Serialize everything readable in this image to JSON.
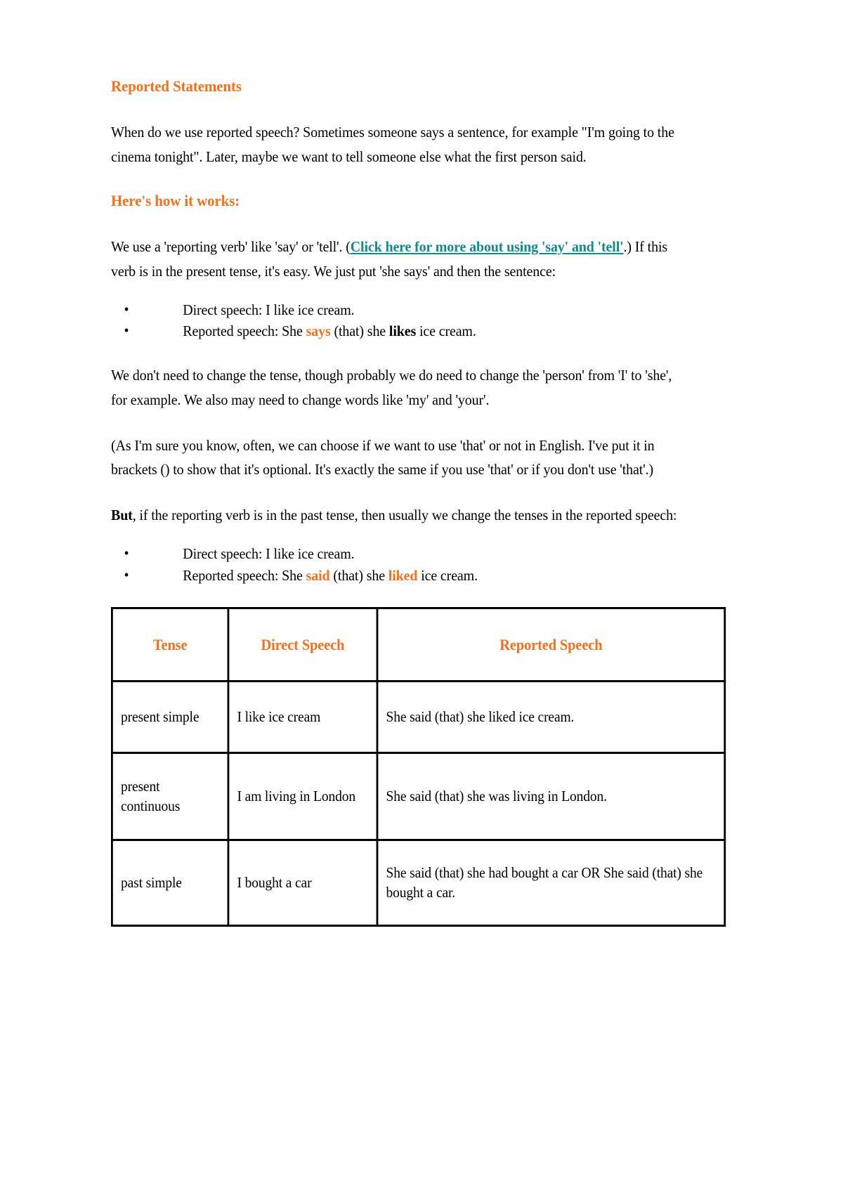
{
  "document": {
    "title": "Reported Statements",
    "intro_paragraph": "When do we use reported speech? Sometimes someone says a sentence, for example \"I'm going to the cinema tonight\". Later, maybe we want to tell someone else what the first person said.",
    "section_heading": "Here's how it works:",
    "explain_lead": "We use a 'reporting verb' like 'say' or 'tell'. (",
    "link_text": "Click here for more about using 'say' and 'tell'",
    "explain_tail": ".) If this verb is in the present tense, it's easy. We just put 'she says' and then the sentence:",
    "bullets_present": [
      {
        "bullet": "•",
        "prefix": "Direct speech: I like ice cream.",
        "highlight1": "",
        "mid": "",
        "highlight2": "",
        "suffix": ""
      },
      {
        "bullet": "•",
        "prefix": "Reported speech: She ",
        "highlight1": "says",
        "mid": " (that) she ",
        "highlight2": "likes",
        "suffix": " ice cream."
      }
    ],
    "paragraph_person": "We don't need to change the tense, though probably we do need to change the 'person' from 'I' to 'she', for example. We also may need to change words like 'my' and 'your'.",
    "paragraph_brackets": "(As I'm sure you know, often, we can choose if we want to use 'that' or not in English. I've put it in brackets () to show that it's optional. It's exactly the same if you use 'that' or if you don't use 'that'.)",
    "but_word": "But",
    "paragraph_but_rest": ", if the reporting verb is in the past tense, then usually we change the tenses in the reported speech:",
    "bullets_past": [
      {
        "bullet": "•",
        "prefix": "Direct speech: I like ice cream.",
        "highlight1": "",
        "mid": "",
        "highlight2": "",
        "suffix": ""
      },
      {
        "bullet": "•",
        "prefix": "Reported speech: She ",
        "highlight1": "said",
        "mid": " (that) she ",
        "highlight2": "liked",
        "suffix": " ice cream."
      }
    ]
  },
  "table": {
    "headers": [
      "Tense",
      "Direct Speech",
      "Reported Speech"
    ],
    "rows": [
      {
        "tense": "present simple",
        "direct": "I like ice cream",
        "reported": "She said (that) she liked ice cream."
      },
      {
        "tense": "present continuous",
        "direct": "I am living in London",
        "reported": "She said (that) she was living in London."
      },
      {
        "tense": "past simple",
        "direct": "I bought a car",
        "reported": "She said (that) she had bought a car OR She said (that) she bought a car."
      }
    ]
  },
  "colors": {
    "heading_orange": "#F4701B",
    "link_teal": "#0E8C8C",
    "text_black": "#000000",
    "page_background": "#FFFFFF",
    "table_border": "#000000"
  }
}
